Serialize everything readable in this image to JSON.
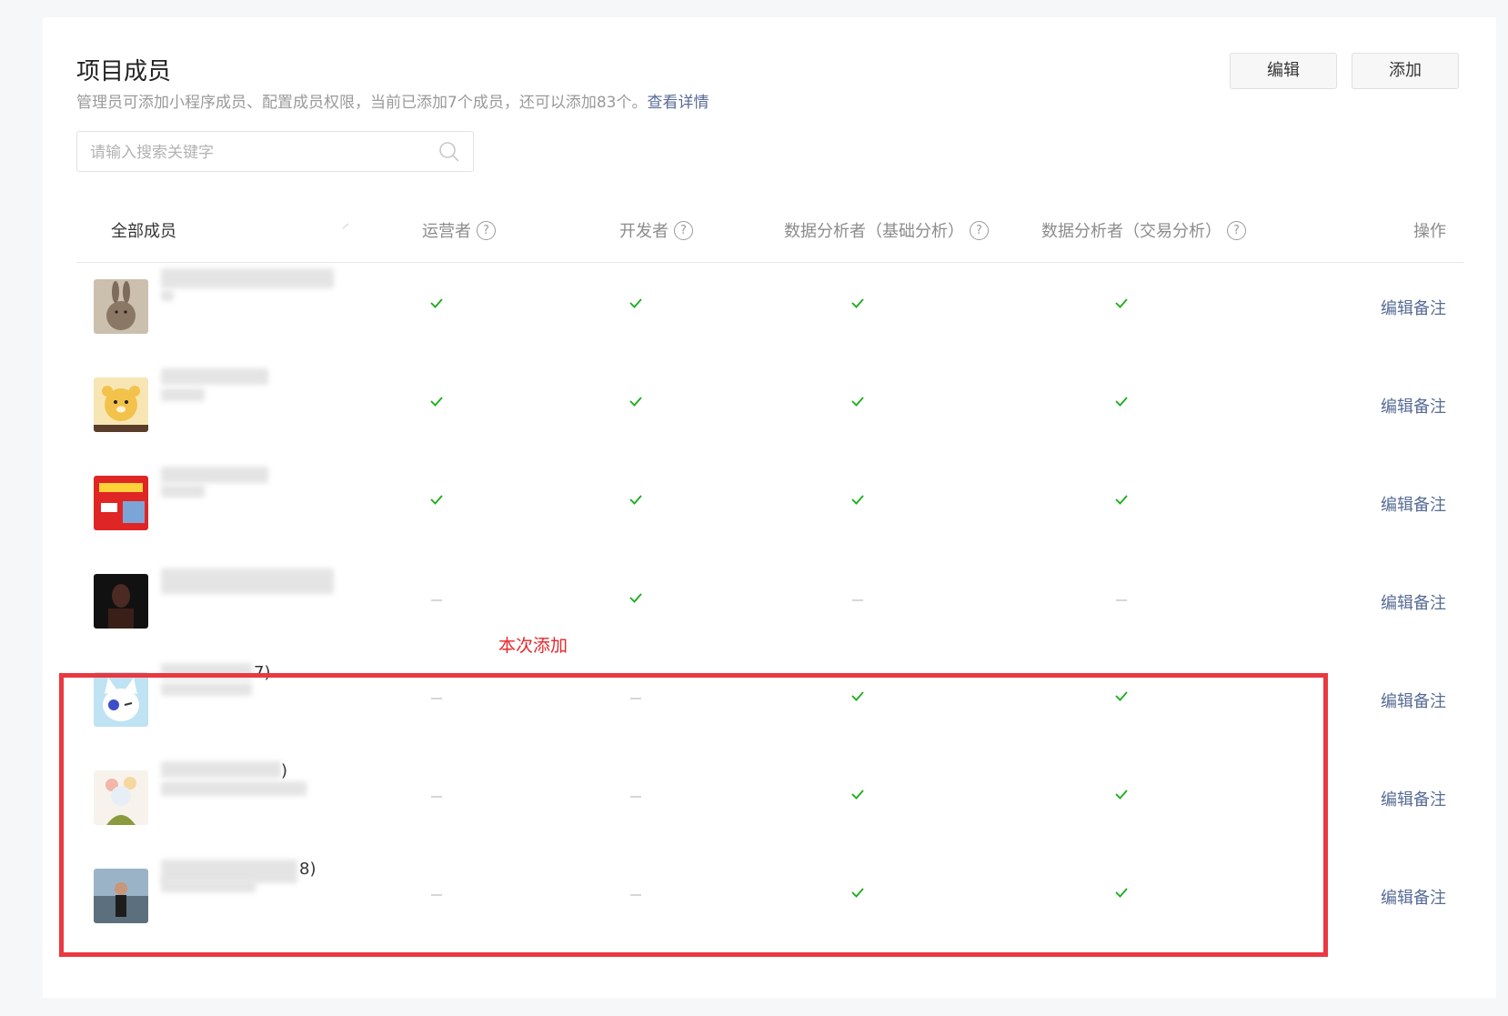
{
  "page": {
    "title": "项目成员",
    "subtitle": "管理员可添加小程序成员、配置成员权限，当前已添加7个成员，还可以添加83个。",
    "detail_link": "查看详情",
    "edit_button": "编辑",
    "add_button": "添加"
  },
  "search": {
    "placeholder": "请输入搜索关键字",
    "value": ""
  },
  "table": {
    "columns": [
      "全部成员",
      "运营者",
      "开发者",
      "数据分析者（基础分析）",
      "数据分析者（交易分析）",
      "操作"
    ],
    "rows": [
      {
        "nick_suffix": "",
        "avatar_icon": "rabbit-avatar",
        "perms": [
          true,
          true,
          true,
          true
        ],
        "action": "编辑备注"
      },
      {
        "nick_suffix": "",
        "avatar_icon": "bear-avatar",
        "perms": [
          true,
          true,
          true,
          true
        ],
        "action": "编辑备注"
      },
      {
        "nick_suffix": "",
        "avatar_icon": "red-poster-avatar",
        "perms": [
          true,
          true,
          true,
          true
        ],
        "action": "编辑备注"
      },
      {
        "nick_suffix": "",
        "avatar_icon": "dark-portrait-avatar",
        "perms": [
          false,
          true,
          false,
          false
        ],
        "action": "编辑备注"
      },
      {
        "nick_suffix": "7)",
        "avatar_icon": "cat-avatar",
        "perms": [
          false,
          false,
          true,
          true
        ],
        "action": "编辑备注"
      },
      {
        "nick_suffix": ")",
        "avatar_icon": "flower-avatar",
        "perms": [
          false,
          false,
          true,
          true
        ],
        "action": "编辑备注"
      },
      {
        "nick_suffix": "8)",
        "avatar_icon": "woman-photo-avatar",
        "perms": [
          false,
          false,
          true,
          true
        ],
        "action": "编辑备注"
      }
    ]
  },
  "annotation": {
    "label": "本次添加",
    "color": "#ea3840"
  },
  "colors": {
    "accent": "#576b95",
    "check": "#1aad19"
  }
}
